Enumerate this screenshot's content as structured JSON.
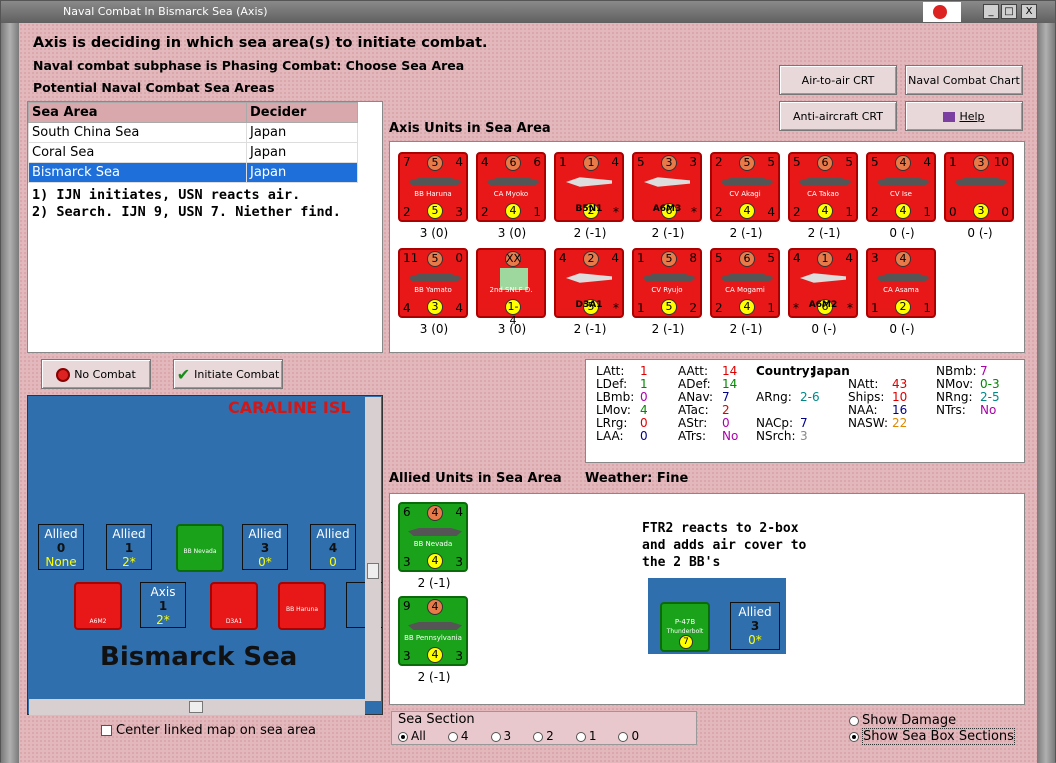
{
  "window": {
    "title": "Naval Combat In Bismarck Sea (Axis)",
    "min": "_",
    "max": "□",
    "close": "X"
  },
  "header": {
    "line1": "Axis is deciding in which sea area(s) to initiate combat.",
    "line2": "Naval combat subphase is Phasing Combat: Choose Sea Area",
    "line3": "Potential Naval Combat Sea Areas"
  },
  "buttons": {
    "air_to_air": "Air-to-air CRT",
    "naval_chart": "Naval Combat Chart",
    "anti_aircraft": "Anti-aircraft CRT",
    "help": "Help",
    "no_combat": "No Combat",
    "initiate": "Initiate Combat"
  },
  "sea_table": {
    "headers": [
      "Sea Area",
      "Decider"
    ],
    "rows": [
      {
        "area": "South China Sea",
        "decider": "Japan"
      },
      {
        "area": "Coral Sea",
        "decider": "Japan"
      },
      {
        "area": "Bismarck Sea",
        "decider": "Japan"
      }
    ]
  },
  "notes": [
    "1) IJN initiates, USN reacts air.",
    "2) Search. IJN 9, USN 7.  Niether find."
  ],
  "axis_title": "Axis Units in Sea Area",
  "axis_units": [
    {
      "name": "BB Haruna",
      "tl": "7",
      "ctop": "5",
      "tr": "4",
      "bl": "2",
      "cbot": "5",
      "br": "3",
      "label": "3 (0)",
      "kind": "ship"
    },
    {
      "name": "CA Myoko",
      "tl": "4",
      "ctop": "6",
      "tr": "6",
      "bl": "2",
      "cbot": "4",
      "br": "1",
      "label": "3 (0)",
      "kind": "ship"
    },
    {
      "name": "B5N1",
      "tl": "1",
      "ctop": "1",
      "tr": "4",
      "bl": "",
      "cbot": "2",
      "br": "*",
      "label": "2 (-1)",
      "kind": "plane"
    },
    {
      "name": "A6M3",
      "tl": "5",
      "ctop": "3",
      "tr": "3",
      "bl": "",
      "cbot": "6",
      "br": "*",
      "label": "2 (-1)",
      "kind": "plane"
    },
    {
      "name": "CV Akagi",
      "tl": "2",
      "ctop": "5",
      "tr": "5",
      "bl": "2",
      "cbot": "4",
      "br": "4",
      "label": "2 (-1)",
      "kind": "ship"
    },
    {
      "name": "CA Takao",
      "tl": "5",
      "ctop": "6",
      "tr": "5",
      "bl": "2",
      "cbot": "4",
      "br": "1",
      "label": "2 (-1)",
      "kind": "ship"
    },
    {
      "name": "CV Ise",
      "tl": "5",
      "ctop": "4",
      "tr": "4",
      "bl": "2",
      "cbot": "4",
      "br": "1",
      "label": "0 (-)",
      "kind": "ship"
    },
    {
      "name": "",
      "tl": "1",
      "ctop": "3",
      "tr": "10",
      "bl": "0",
      "cbot": "3",
      "br": "0",
      "label": "0 (-)",
      "kind": "ship"
    },
    {
      "name": "BB Yamato",
      "tl": "11",
      "ctop": "5",
      "tr": "0",
      "bl": "4",
      "cbot": "3",
      "br": "4",
      "label": "3 (0)",
      "kind": "ship"
    },
    {
      "name": "2nd SNLF D.",
      "tl": "",
      "ctop": "XX",
      "tr": "",
      "bl": "",
      "cbot": "1-4",
      "br": "",
      "label": "3 (0)",
      "kind": "land"
    },
    {
      "name": "D3A1",
      "tl": "4",
      "ctop": "2",
      "tr": "4",
      "bl": "",
      "cbot": "5",
      "br": "*",
      "label": "2 (-1)",
      "kind": "plane"
    },
    {
      "name": "CV Ryujo",
      "tl": "1",
      "ctop": "5",
      "tr": "8",
      "bl": "1",
      "cbot": "5",
      "br": "2",
      "label": "2 (-1)",
      "kind": "ship"
    },
    {
      "name": "CA Mogami",
      "tl": "5",
      "ctop": "6",
      "tr": "5",
      "bl": "2",
      "cbot": "4",
      "br": "1",
      "label": "2 (-1)",
      "kind": "ship"
    },
    {
      "name": "A6M2",
      "tl": "4",
      "ctop": "1",
      "tr": "4",
      "bl": "*",
      "cbot": "6",
      "br": "*",
      "label": "0 (-)",
      "kind": "plane"
    },
    {
      "name": "CA Asama",
      "tl": "3",
      "ctop": "4",
      "tr": "",
      "bl": "1",
      "cbot": "2",
      "br": "1",
      "label": "0 (-)",
      "kind": "ship"
    }
  ],
  "stats": {
    "latt_l": "LAtt:",
    "latt": "1",
    "ldef_l": "LDef:",
    "ldef": "1",
    "lbmb_l": "LBmb:",
    "lbmb": "0",
    "lmov_l": "LMov:",
    "lmov": "4",
    "lrrg_l": "LRrg:",
    "lrrg": "0",
    "laa_l": "LAA:",
    "laa": "0",
    "aatt_l": "AAtt:",
    "aatt": "14",
    "adef_l": "ADef:",
    "adef": "14",
    "anav_l": "ANav:",
    "anav": "7",
    "atac_l": "ATac:",
    "atac": "2",
    "astr_l": "AStr:",
    "astr": "0",
    "atrs_l": "ATrs:",
    "atrs": "No",
    "country_l": "Country:",
    "country": "Japan",
    "arng_l": "ARng:",
    "arng": "2-6",
    "nacp_l": "NACp:",
    "nacp": "7",
    "nsrch_l": "NSrch:",
    "nsrch": "3",
    "natt_l": "NAtt:",
    "natt": "43",
    "ships_l": "Ships:",
    "ships": "10",
    "naa_l": "NAA:",
    "naa": "16",
    "nasw_l": "NASW:",
    "nasw": "22",
    "nbmb_l": "NBmb:",
    "nbmb": "7",
    "nmov_l": "NMov:",
    "nmov": "0-3",
    "nrng_l": "NRng:",
    "nrng": "2-5",
    "ntrs_l": "NTrs:",
    "ntrs": "No"
  },
  "allied_title": "Allied Units in Sea Area",
  "weather": "Weather:  Fine",
  "allied_units": [
    {
      "name": "BB Nevada",
      "tl": "6",
      "ctop": "4",
      "tr": "4",
      "bl": "3",
      "cbot": "4",
      "br": "3",
      "label": "2 (-1)"
    },
    {
      "name": "BB Pennsylvania",
      "tl": "9",
      "ctop": "4",
      "tr": "",
      "bl": "3",
      "cbot": "4",
      "br": "3",
      "label": "2 (-1)"
    }
  ],
  "annotation": [
    "FTR2 reacts to 2-box",
    "and adds air cover to",
    "the 2 BB's"
  ],
  "mini": {
    "plane": "P-47B",
    "plane_sub": "Thunderbolt",
    "allied": "Allied",
    "num": "3",
    "sub": "0*"
  },
  "map": {
    "island": "CARALINE ISL",
    "sea": "Bismarck Sea",
    "boxes": [
      {
        "t": "Allied",
        "n": "0",
        "s": "None"
      },
      {
        "t": "Allied",
        "n": "1",
        "s": "2*"
      },
      {
        "t": "Allied",
        "n": "3",
        "s": "0*"
      },
      {
        "t": "Allied",
        "n": "4",
        "s": "0"
      },
      {
        "t": "Axis",
        "n": "1",
        "s": "2*"
      },
      {
        "t": "A",
        "n": "",
        "s": ""
      }
    ],
    "unit_a": "A6M2",
    "unit_b": "D3A1",
    "unit_c": "BB Haruna",
    "unit_d": "BB Nevada"
  },
  "center_check": "Center linked map on sea area",
  "sea_section": {
    "title": "Sea Section",
    "opts": [
      "All",
      "4",
      "3",
      "2",
      "1",
      "0"
    ]
  },
  "show_damage": "Show Damage",
  "show_boxes": "Show Sea Box Sections"
}
